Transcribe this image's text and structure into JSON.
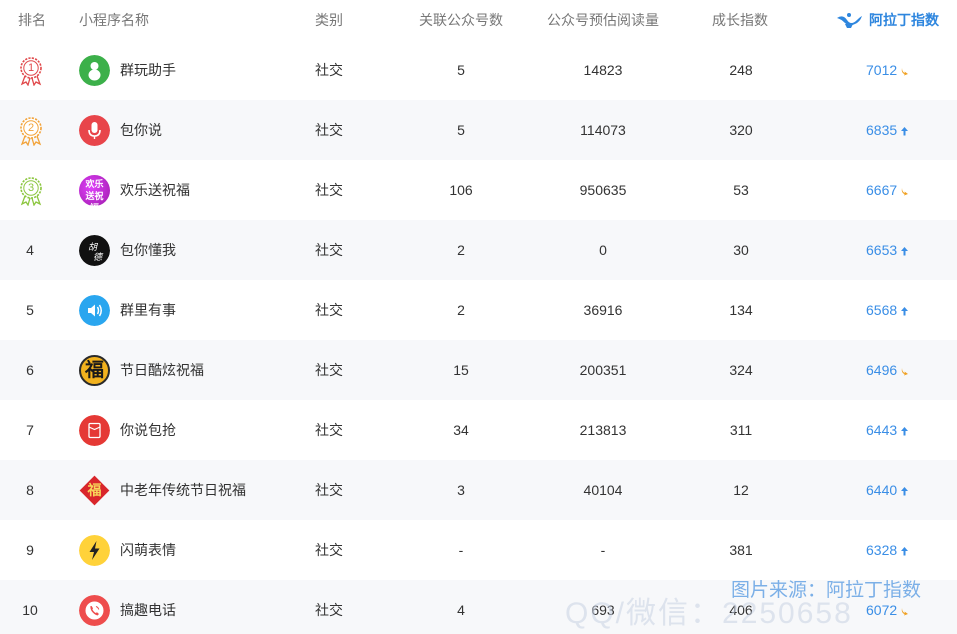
{
  "header": {
    "rank": "排名",
    "name": "小程序名称",
    "category": "类别",
    "linked_accounts": "关联公众号数",
    "est_reads": "公众号预估阅读量",
    "growth": "成长指数",
    "brand": "阿拉丁指数"
  },
  "rows": [
    {
      "rank": "1",
      "name": "群玩助手",
      "category": "社交",
      "linked": "5",
      "reads": "14823",
      "growth": "248",
      "index": "7012",
      "trend": "down"
    },
    {
      "rank": "2",
      "name": "包你说",
      "category": "社交",
      "linked": "5",
      "reads": "114073",
      "growth": "320",
      "index": "6835",
      "trend": "up"
    },
    {
      "rank": "3",
      "name": "欢乐送祝福",
      "category": "社交",
      "linked": "106",
      "reads": "950635",
      "growth": "53",
      "index": "6667",
      "trend": "down",
      "icon_text": "欢乐送祝福"
    },
    {
      "rank": "4",
      "name": "包你懂我",
      "category": "社交",
      "linked": "2",
      "reads": "0",
      "growth": "30",
      "index": "6653",
      "trend": "up"
    },
    {
      "rank": "5",
      "name": "群里有事",
      "category": "社交",
      "linked": "2",
      "reads": "36916",
      "growth": "134",
      "index": "6568",
      "trend": "up"
    },
    {
      "rank": "6",
      "name": "节日酷炫祝福",
      "category": "社交",
      "linked": "15",
      "reads": "200351",
      "growth": "324",
      "index": "6496",
      "trend": "down",
      "icon_text": "福"
    },
    {
      "rank": "7",
      "name": "你说包抢",
      "category": "社交",
      "linked": "34",
      "reads": "213813",
      "growth": "311",
      "index": "6443",
      "trend": "up"
    },
    {
      "rank": "8",
      "name": "中老年传统节日祝福",
      "category": "社交",
      "linked": "3",
      "reads": "40104",
      "growth": "12",
      "index": "6440",
      "trend": "up",
      "icon_text": "福"
    },
    {
      "rank": "9",
      "name": "闪萌表情",
      "category": "社交",
      "linked": "-",
      "reads": "-",
      "growth": "381",
      "index": "6328",
      "trend": "up"
    },
    {
      "rank": "10",
      "name": "搞趣电话",
      "category": "社交",
      "linked": "4",
      "reads": "693",
      "growth": "406",
      "index": "6072",
      "trend": "down"
    }
  ],
  "watermark": "图片来源：阿拉丁指数",
  "watermark2": "QQ/微信：2250658",
  "colors": {
    "accent": "#3a8ee6",
    "down": "#f0a020",
    "up": "#3a8ee6"
  }
}
